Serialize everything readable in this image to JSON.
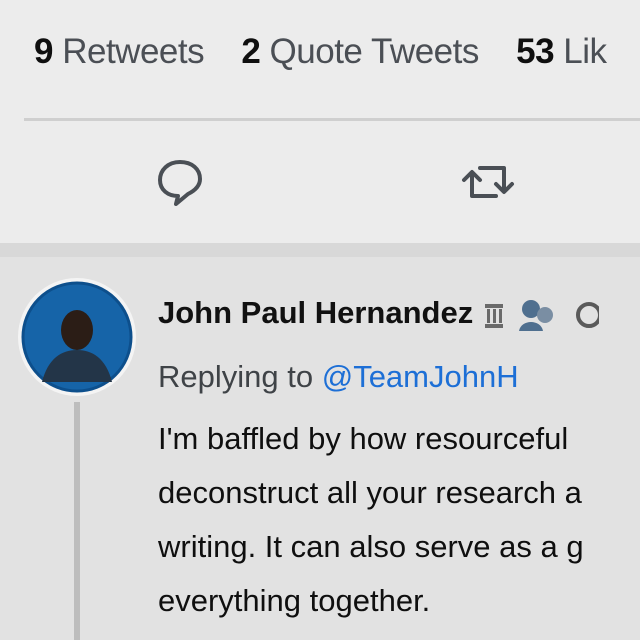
{
  "stats": [
    {
      "count": "9",
      "label": "Retweets"
    },
    {
      "count": "2",
      "label": "Quote Tweets"
    },
    {
      "count": "53",
      "label": "Lik"
    }
  ],
  "actions": [
    "reply-icon",
    "retweet-icon"
  ],
  "reply_tweet": {
    "author_name": "John Paul Hernandez",
    "replying_prefix": "Replying to",
    "replying_handle": "@TeamJohnH",
    "text_lines": [
      "I'm baffled by how resourceful",
      "deconstruct all your research a",
      "writing. It can also serve as a g",
      "everything together."
    ]
  },
  "colors": {
    "link": "#1d6fd6",
    "muted": "#4b4f55",
    "text": "#0f0f0f"
  }
}
